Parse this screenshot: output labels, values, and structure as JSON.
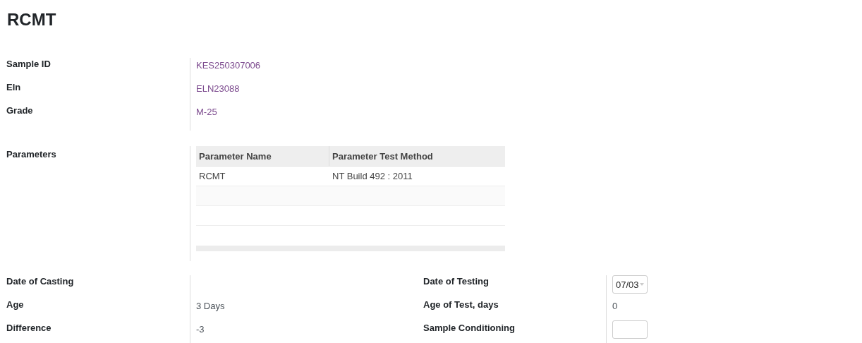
{
  "title": "RCMT",
  "fields": [
    {
      "label": "Sample ID",
      "value": "KES250307006",
      "kind": "link"
    },
    {
      "label": "Eln",
      "value": "ELN23088",
      "kind": "link"
    },
    {
      "label": "Grade",
      "value": "M-25",
      "kind": "link"
    }
  ],
  "parameters": {
    "label": "Parameters",
    "columns": [
      "Parameter Name",
      "Parameter Test Method"
    ],
    "rows": [
      [
        "RCMT",
        "NT Build 492 : 2011"
      ]
    ]
  },
  "left_fields": [
    {
      "label": "Date of Casting",
      "kind": "text"
    },
    {
      "label": "Age",
      "value": "3 Days",
      "kind": "text"
    },
    {
      "label": "Difference",
      "value": "-3",
      "kind": "text"
    }
  ],
  "right_fields": [
    {
      "label": "Date of Testing",
      "value": "07/03",
      "kind": "date"
    },
    {
      "label": "Age of Test, days",
      "value": "0",
      "kind": "text"
    },
    {
      "label": "Sample Conditioning",
      "kind": "input"
    }
  ]
}
